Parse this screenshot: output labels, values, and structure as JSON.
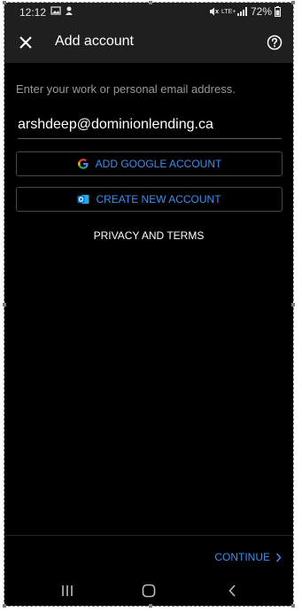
{
  "status_bar": {
    "time": "12:12",
    "battery": "72%",
    "network": "LTE+",
    "icons": [
      "image-notification-icon",
      "app-notification-icon",
      "mute-icon",
      "signal-icon",
      "battery-icon"
    ]
  },
  "app_bar": {
    "title": "Add account",
    "close_icon": "close-icon",
    "help_icon": "help-icon"
  },
  "form": {
    "instruction": "Enter your work or personal email address.",
    "email_value": "arshdeep@dominionlending.ca"
  },
  "buttons": {
    "google_label": "ADD GOOGLE ACCOUNT",
    "create_label": "CREATE NEW ACCOUNT",
    "privacy_label": "PRIVACY AND TERMS",
    "continue_label": "CONTINUE"
  },
  "colors": {
    "accent": "#3d8ef0",
    "background": "#000000",
    "app_bar": "#1f1f1f",
    "text_secondary": "#9a9a9a",
    "outlook_blue": "#0f6fc6"
  },
  "nav_bar": {
    "icons": [
      "recents-icon",
      "home-icon",
      "back-icon"
    ]
  }
}
